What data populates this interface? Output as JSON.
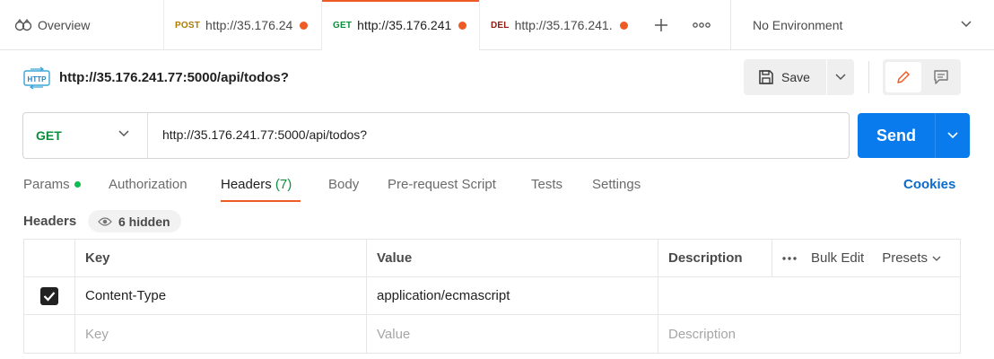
{
  "tabbar": {
    "overview_label": "Overview",
    "tabs": [
      {
        "method": "POST",
        "method_color": "#ad7a03",
        "label": "http://35.176.24",
        "active": false
      },
      {
        "method": "GET",
        "method_color": "#0b8f3c",
        "label": "http://35.176.241",
        "active": true
      },
      {
        "method": "DEL",
        "method_color": "#8e1a10",
        "label": "http://35.176.241.",
        "active": false
      }
    ],
    "new_tab_icon": "plus-icon",
    "more_icon": "ellipsis-icon",
    "environment": "No Environment"
  },
  "request": {
    "title": "http://35.176.241.77:5000/api/todos?",
    "save_label": "Save",
    "method": "GET",
    "url": "http://35.176.241.77:5000/api/todos?",
    "send_label": "Send"
  },
  "request_tabs": {
    "params": "Params",
    "authorization": "Authorization",
    "headers": "Headers",
    "headers_count": "(7)",
    "body": "Body",
    "pre_request": "Pre-request Script",
    "tests": "Tests",
    "settings": "Settings",
    "cookies": "Cookies"
  },
  "headers_section": {
    "label": "Headers",
    "hidden_label": "6 hidden",
    "columns": {
      "key": "Key",
      "value": "Value",
      "description": "Description"
    },
    "bulk_edit": "Bulk Edit",
    "presets": "Presets",
    "rows": [
      {
        "checked": true,
        "key": "Content-Type",
        "value": "application/ecmascript",
        "description": ""
      }
    ],
    "new_row": {
      "key_placeholder": "Key",
      "value_placeholder": "Value",
      "description_placeholder": "Description"
    }
  },
  "colors": {
    "accent": "#ef5b25",
    "send_blue": "#097bed",
    "get_green": "#0b8f3c",
    "link_blue": "#0b6bcb"
  }
}
